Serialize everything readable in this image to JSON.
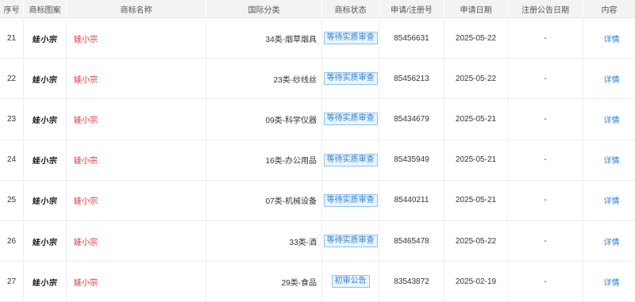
{
  "table": {
    "columns": [
      "序号",
      "商标图案",
      "商标名称",
      "国际分类",
      "商标状态",
      "申请/注册号",
      "申请日期",
      "注册公告日期",
      "内容"
    ],
    "rows": [
      {
        "index": "21",
        "logo_text": "娃小宗",
        "name": "娃小宗",
        "class": "34类-烟草烟具",
        "status": "等待实质审查",
        "reg_no": "85456631",
        "date": "2025-05-22",
        "pub_date": "-",
        "action": "详情"
      },
      {
        "index": "22",
        "logo_text": "娃小宗",
        "name": "娃小宗",
        "class": "23类-纱线丝",
        "status": "等待实质审查",
        "reg_no": "85456213",
        "date": "2025-05-22",
        "pub_date": "-",
        "action": "详情"
      },
      {
        "index": "23",
        "logo_text": "娃小宗",
        "name": "娃小宗",
        "class": "09类-科学仪器",
        "status": "等待实质审查",
        "reg_no": "85434679",
        "date": "2025-05-21",
        "pub_date": "-",
        "action": "详情"
      },
      {
        "index": "24",
        "logo_text": "娃小宗",
        "name": "娃小宗",
        "class": "16类-办公用品",
        "status": "等待实质审查",
        "reg_no": "85435949",
        "date": "2025-05-21",
        "pub_date": "-",
        "action": "详情"
      },
      {
        "index": "25",
        "logo_text": "娃小宗",
        "name": "娃小宗",
        "class": "07类-机械设备",
        "status": "等待实质审查",
        "reg_no": "85440211",
        "date": "2025-05-21",
        "pub_date": "-",
        "action": "详情"
      },
      {
        "index": "26",
        "logo_text": "娃小宗",
        "name": "娃小宗",
        "class": "33类-酒",
        "status": "等待实质审查",
        "reg_no": "85465478",
        "date": "2025-05-22",
        "pub_date": "-",
        "action": "详情"
      },
      {
        "index": "27",
        "logo_text": "娃小宗",
        "name": "娃小宗",
        "class": "29类-食品",
        "status": "初审公告",
        "reg_no": "83543872",
        "date": "2025-02-19",
        "pub_date": "-",
        "action": "详情"
      }
    ]
  }
}
